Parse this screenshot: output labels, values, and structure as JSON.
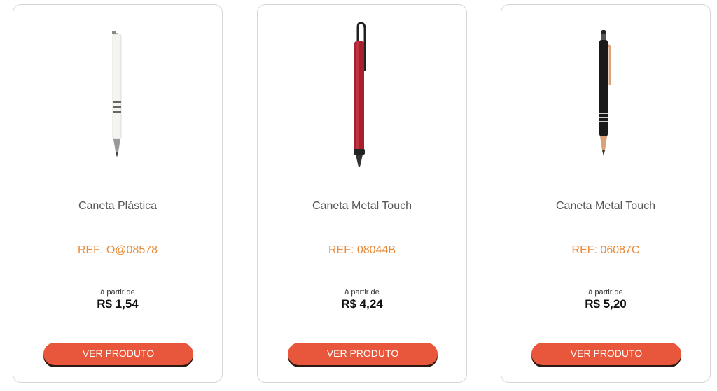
{
  "products": [
    {
      "title": "Caneta Plástica",
      "ref": "REF: O@08578",
      "from_label": "à partir de",
      "price": "R$ 1,54",
      "button_label": "VER PRODUTO",
      "image_icon": "white-pen-icon"
    },
    {
      "title": "Caneta Metal Touch",
      "ref": "REF: 08044B",
      "from_label": "à partir de",
      "price": "R$ 4,24",
      "button_label": "VER PRODUTO",
      "image_icon": "red-pen-icon"
    },
    {
      "title": "Caneta Metal Touch",
      "ref": "REF: 06087C",
      "from_label": "à partir de",
      "price": "R$ 5,20",
      "button_label": "VER PRODUTO",
      "image_icon": "black-pen-icon"
    }
  ],
  "colors": {
    "ref_text": "#e88a3a",
    "button_bg": "#e8573b",
    "title_text": "#555555"
  }
}
